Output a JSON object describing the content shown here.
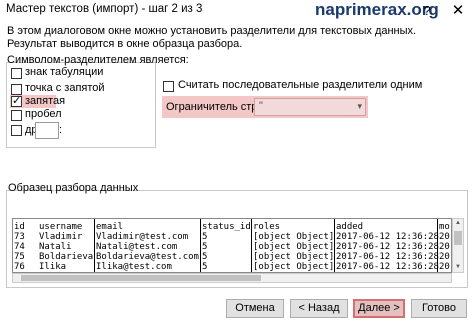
{
  "window": {
    "title": "Мастер текстов (импорт) - шаг 2 из 3",
    "watermark": "naprimerax.org",
    "help_glyph": "?",
    "close_glyph": "✕"
  },
  "description": "В этом диалоговом окне можно установить разделители для текстовых данных. Результат выводится в окне образца разбора.",
  "delimiters": {
    "group_title": "Символом-разделителем является:",
    "items": [
      {
        "label": "знак табуляции",
        "underline_char": "з",
        "checked": false,
        "highlighted": false
      },
      {
        "label": "точка с запятой",
        "underline_char": "т",
        "checked": false,
        "highlighted": false
      },
      {
        "label": "запятая",
        "underline_char": "з",
        "checked": true,
        "highlighted": true
      },
      {
        "label": "пробел",
        "underline_char": "п",
        "checked": false,
        "highlighted": false
      },
      {
        "label": "другой:",
        "underline_char": "д",
        "checked": false,
        "highlighted": false
      }
    ],
    "other_value": ""
  },
  "consecutive": {
    "label": "Считать последовательные разделители одним",
    "checked": false
  },
  "qualifier": {
    "label": "Ограничитель строк:",
    "value": "\"",
    "arrow": "▾"
  },
  "preview": {
    "title": "Образец разбора данных",
    "columns": [
      "id",
      "username",
      "email",
      "status_id",
      "roles",
      "added",
      "mo"
    ],
    "rows": [
      [
        "73",
        "Vladimir",
        "Vladimir@test.com",
        "5",
        "[object Object]",
        "2017-06-12 12:36:28",
        "20"
      ],
      [
        "74",
        "Natali",
        "Natali@test.com",
        "5",
        "[object Object]",
        "2017-06-12 12:36:28",
        "20"
      ],
      [
        "75",
        "Boldarieva",
        "Boldarieva@test.com",
        "5",
        "[object Object]",
        "2017-06-12 12:36:28",
        "20"
      ],
      [
        "76",
        "Ilika",
        "Ilika@test.com",
        "5",
        "[object Object]",
        "2017-06-12 12:36:28",
        "20"
      ]
    ]
  },
  "buttons": {
    "cancel": "Отмена",
    "back": "< Назад",
    "next": "Далее >",
    "finish": "Готово"
  },
  "colors": {
    "highlight": "#f4c7c7",
    "watermark": "#1a3a6e"
  }
}
